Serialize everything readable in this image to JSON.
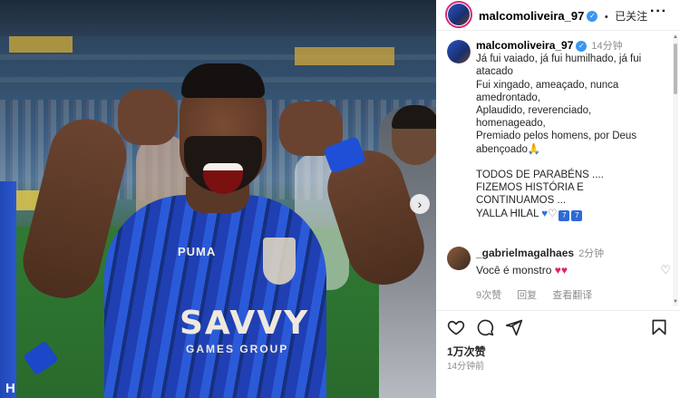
{
  "post": {
    "username": "malcomoliveira_97",
    "follow_status": "已关注",
    "caption_time": "14分钟",
    "caption_lines": [
      "Já fui vaiado, já fui humilhado, já fui",
      "atacado",
      "Fui xingado, ameaçado, nunca",
      "amedrontado,",
      "Aplaudido, reverenciado,",
      "homenageado,",
      "Premiado pelos homens, por Deus",
      "abençoado",
      "",
      "TODOS DE PARABÉNS ....",
      "FIZEMOS HISTÓRIA E",
      "CONTINUAMOS ...",
      "YALLA HILAL"
    ],
    "likes": "1万次赞",
    "posted_time": "14分钟前"
  },
  "comment": {
    "username": "_gabrielmagalhaes",
    "time": "2分钟",
    "text": "Você é monstro",
    "likes": "9次赞",
    "reply": "回复",
    "translate": "查看翻译"
  },
  "photo": {
    "sponsor": "SAVVY",
    "sponsor_sub": "GAMES GROUP",
    "brand": "PUMA",
    "watermark": "H"
  },
  "icons": {
    "more": "more-horizontal-icon",
    "like": "heart-icon",
    "comment": "comment-icon",
    "share": "send-icon",
    "save": "bookmark-icon",
    "verified": "verified-badge-icon",
    "next": "chevron-right-icon"
  },
  "colors": {
    "verified": "#3897f0",
    "story_ring": "#d62976",
    "red_heart": "#e0245e",
    "jersey_blue": "#2b5ad9"
  }
}
